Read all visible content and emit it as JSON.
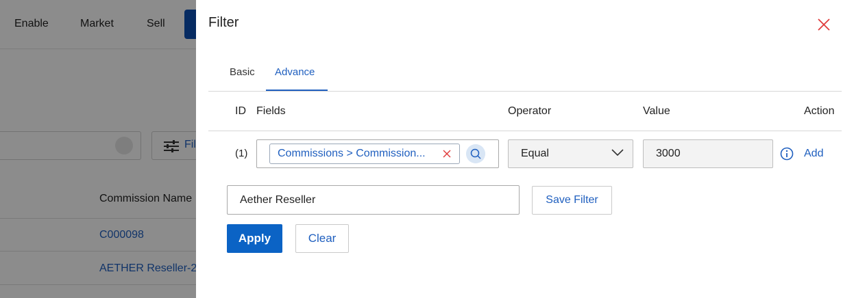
{
  "background": {
    "nav": {
      "enable": "Enable",
      "market": "Market",
      "sell": "Sell"
    },
    "filter_button_label": "Fil",
    "table": {
      "column_header": "Commission Name",
      "rows": [
        "C000098",
        "AETHER Reseller-2"
      ]
    }
  },
  "filter": {
    "title": "Filter",
    "tabs": {
      "basic": "Basic",
      "advance": "Advance",
      "active": "Advance"
    },
    "columns": {
      "id": "ID",
      "fields": "Fields",
      "operator": "Operator",
      "value": "Value",
      "action": "Action"
    },
    "rows": [
      {
        "id": "(1)",
        "field_chip": "Commissions > Commission...",
        "operator": "Equal",
        "value": "3000",
        "action": "Add"
      }
    ],
    "filter_name": "Aether Reseller",
    "save_filter": "Save Filter",
    "apply": "Apply",
    "clear": "Clear"
  },
  "icons": {
    "close": "close-icon",
    "chip_remove": "close-icon",
    "search": "search-icon",
    "chevron": "chevron-down-icon",
    "info": "info-icon",
    "filter": "sliders-icon"
  },
  "colors": {
    "accent": "#1f5fbf",
    "primary_button": "#0b63c5",
    "close": "#e03a3a",
    "overlay": "rgba(0,0,0,0.45)"
  }
}
